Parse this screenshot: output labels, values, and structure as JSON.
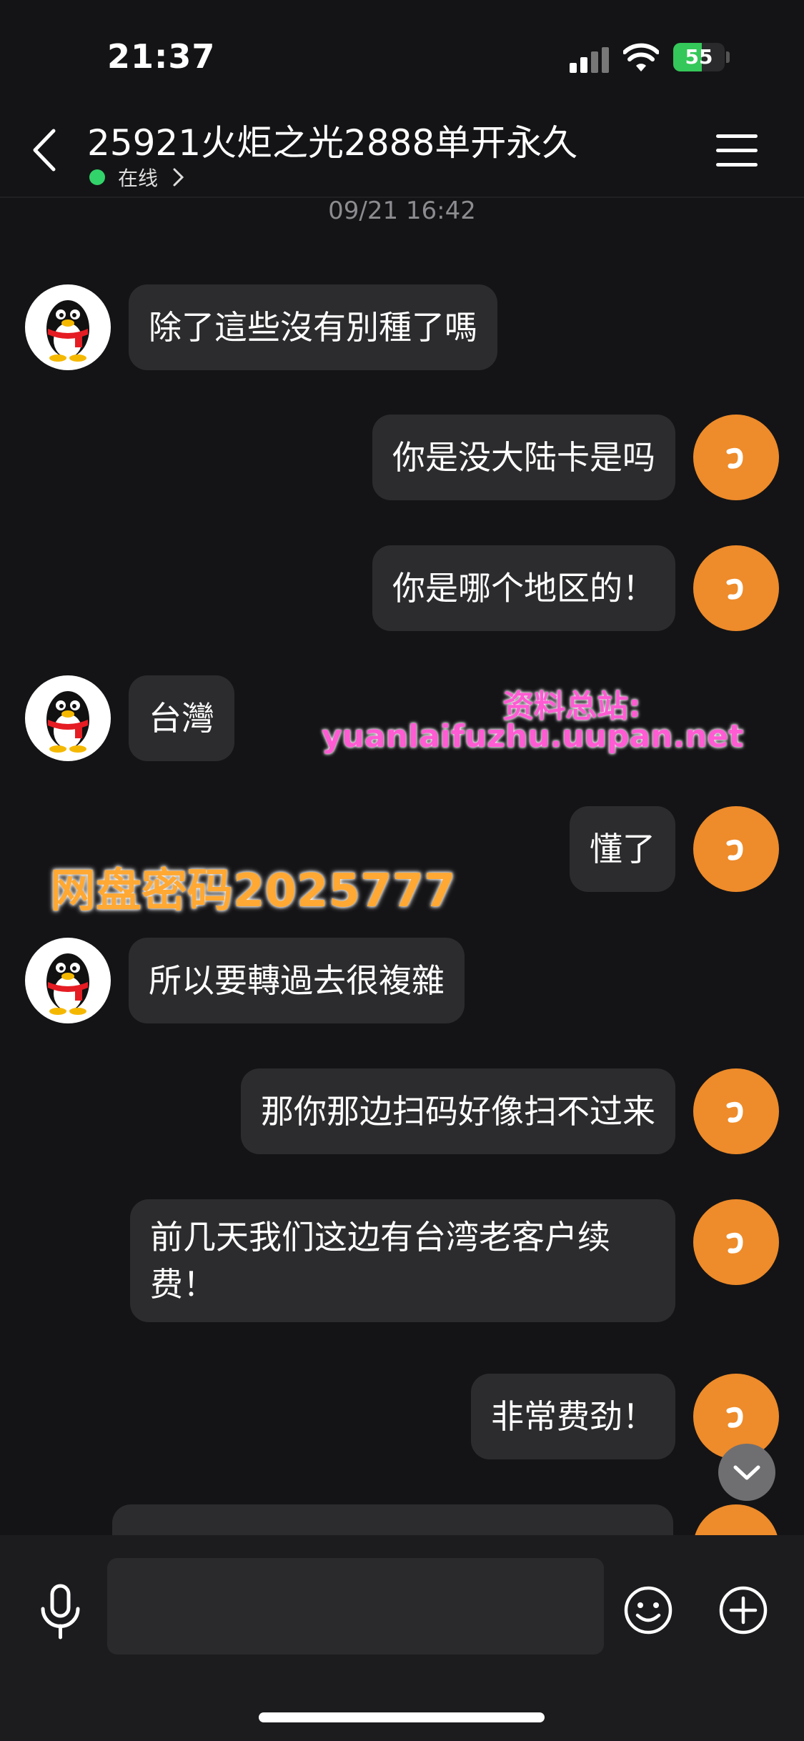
{
  "status": {
    "time": "21:37",
    "battery": "55",
    "battery_level": 0.55
  },
  "header": {
    "title": "25921火炬之光2888单开永久",
    "online": "在线"
  },
  "timestamp": "09/21 16:42",
  "messages": [
    {
      "side": "left",
      "text": "除了這些沒有別種了嗎"
    },
    {
      "side": "right",
      "text": "你是没大陆卡是吗"
    },
    {
      "side": "right",
      "text": "你是哪个地区的！"
    },
    {
      "side": "left",
      "text": "台灣"
    },
    {
      "side": "right",
      "text": "懂了"
    },
    {
      "side": "left",
      "text": "所以要轉過去很複雜"
    },
    {
      "side": "right",
      "text": "那你那边扫码好像扫不过来"
    },
    {
      "side": "right",
      "text": "前几天我们这边有台湾老客户续费！"
    },
    {
      "side": "right",
      "text": "非常费劲！"
    }
  ],
  "watermarks": {
    "site_label": "资料总站:",
    "site_url": "yuanlaifuzhu.uupan.net",
    "password": "网盘密码2025777"
  },
  "icons": {
    "back": "chevron-left-icon",
    "menu": "hamburger-menu-icon",
    "mic": "microphone-icon",
    "emoji": "smiley-icon",
    "plus": "plus-circle-icon",
    "scroll": "chevron-down-icon"
  },
  "colors": {
    "background": "#141416",
    "bubble": "#2c2c2e",
    "self_avatar": "#ee8b2a",
    "online": "#32d36a",
    "watermark_pink": "#ff5bd3",
    "watermark_orange": "#ffa833"
  },
  "input": {
    "value": "",
    "placeholder": ""
  }
}
